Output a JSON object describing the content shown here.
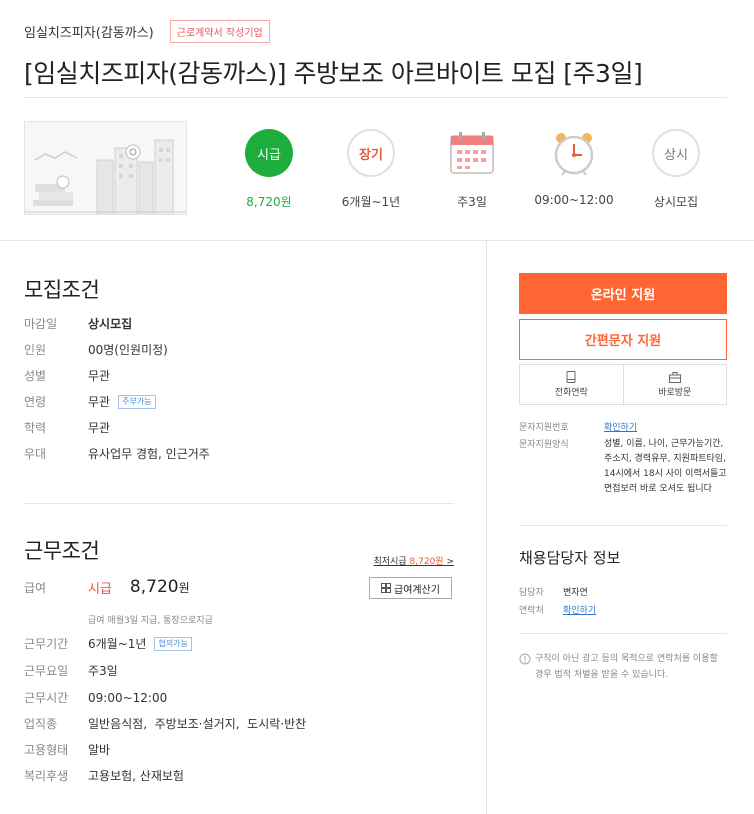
{
  "header": {
    "company": "임실치즈피자(감동까스)",
    "badge": "근로계약서 작성기업",
    "title": "[임실치즈피자(감동까스)] 주방보조 아르바이트 모집 [주3일]"
  },
  "summary": {
    "items": [
      {
        "icon_text": "시급",
        "value": "8,720원"
      },
      {
        "icon_text": "장기",
        "value": "6개월~1년"
      },
      {
        "icon": "calendar-icon",
        "value": "주3일"
      },
      {
        "icon": "clock-icon",
        "value": "09:00~12:00"
      },
      {
        "icon_text": "상시",
        "value": "상시모집"
      }
    ]
  },
  "recruit": {
    "title": "모집조건",
    "rows": [
      {
        "label": "마감일",
        "value": "상시모집"
      },
      {
        "label": "인원",
        "value": "00명(인원미정)"
      },
      {
        "label": "성별",
        "value": "무관"
      },
      {
        "label": "연령",
        "value": "무관",
        "tag": "주부가능"
      },
      {
        "label": "학력",
        "value": "무관"
      },
      {
        "label": "우대",
        "value": "유사업무 경험, 인근거주"
      }
    ]
  },
  "work": {
    "title": "근무조건",
    "min_wage_prefix": "최저시급",
    "min_wage_value": "8,720원",
    "min_wage_suffix": ">",
    "pay_label": "급여",
    "pay_type": "시급",
    "pay_amount": "8,720",
    "pay_unit": "원",
    "calc_button": "급여계산기",
    "pay_note": "급여 매월3일 지급, 통장으로지급",
    "rows": [
      {
        "label": "근무기간",
        "value": "6개월~1년",
        "tag": "협의가능"
      },
      {
        "label": "근무요일",
        "value": "주3일"
      },
      {
        "label": "근무시간",
        "value": "09:00~12:00"
      },
      {
        "label": "업직종",
        "value": "일반음식점,  주방보조·설거지,  도시락·반찬"
      },
      {
        "label": "고용형태",
        "value": "알바"
      },
      {
        "label": "복리후생",
        "value": "고용보험, 산재보험"
      }
    ]
  },
  "apply": {
    "online": "온라인 지원",
    "sms": "간편문자 지원",
    "call": "전화연락",
    "visit": "바로방문",
    "sms_number_label": "문자지원번호",
    "sms_number_link": "확인하기",
    "sms_format_label": "문자지원양식",
    "sms_format_text": "성별, 이름, 나이, 근무가능기간, 주소지, 경력유무, 지원파트타임, 14시에서 18시 사이 이력서들고 면접보러 바로 오셔도 됩니다"
  },
  "manager": {
    "title": "채용담당자 정보",
    "name_label": "담당자",
    "name": "변자연",
    "contact_label": "연락처",
    "contact_link": "확인하기",
    "notice": "구직이 아닌 광고 등의 목적으로 연락처를 이용할 경우 법적 처벌을 받을 수 있습니다."
  },
  "colors": {
    "accent": "#ff6633",
    "green": "#1cad3c",
    "link": "#2e76d2"
  }
}
